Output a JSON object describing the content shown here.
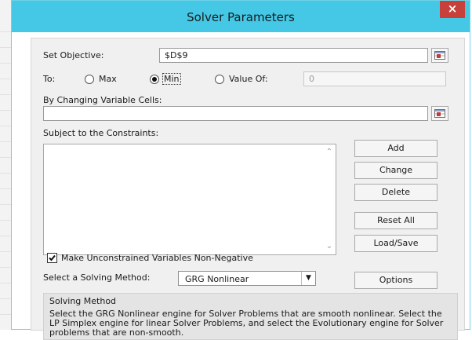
{
  "dialog": {
    "title": "Solver Parameters",
    "close_label": "×"
  },
  "objective": {
    "label": "Set Objective:",
    "value": "$D$9"
  },
  "to": {
    "label": "To:",
    "options": [
      {
        "label": "Max",
        "checked": false
      },
      {
        "label": "Min",
        "checked": true
      },
      {
        "label": "Value Of:",
        "checked": false
      }
    ],
    "value_of": "0"
  },
  "changing_cells": {
    "label": "By Changing Variable Cells:",
    "value": ""
  },
  "constraints": {
    "label": "Subject to the Constraints:",
    "items": []
  },
  "buttons": {
    "add": "Add",
    "change": "Change",
    "delete": "Delete",
    "reset_all": "Reset All",
    "load_save": "Load/Save",
    "options": "Options"
  },
  "nonnegative": {
    "label": "Make Unconstrained Variables Non-Negative",
    "checked": true
  },
  "method": {
    "label": "Select a Solving Method:",
    "selected": "GRG Nonlinear"
  },
  "solving_method": {
    "title": "Solving Method",
    "description": "Select the GRG Nonlinear engine for Solver Problems that are smooth nonlinear. Select the LP Simplex engine for linear Solver Problems, and select the Evolutionary engine for Solver problems that are non-smooth."
  },
  "colors": {
    "titlebar": "#44c8e6",
    "close": "#c7403a"
  },
  "icons": {
    "collapse": "range-selector-icon",
    "dropdown": "chevron-down-icon",
    "check": "checkmark-icon"
  }
}
